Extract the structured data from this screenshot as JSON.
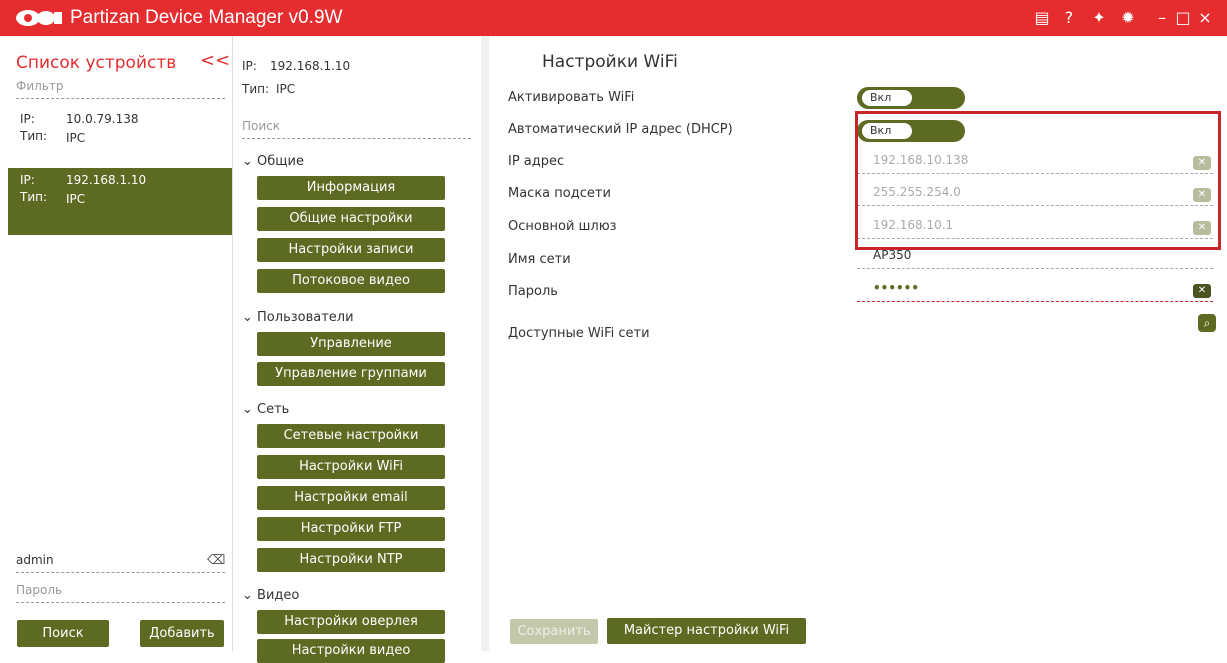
{
  "app": {
    "title": "Partizan Device Manager v0.9W"
  },
  "sidebar": {
    "title": "Список устройств",
    "collapse": "<<",
    "filter_placeholder": "Фильтр",
    "devices": [
      {
        "ip_label": "IP:",
        "ip": "10.0.79.138",
        "type_label": "Тип:",
        "type": "IPC"
      },
      {
        "ip_label": "IP:",
        "ip": "192.168.1.10",
        "type_label": "Тип:",
        "type": "IPC"
      }
    ],
    "username": "admin",
    "password_placeholder": "Пароль",
    "search_label": "Поиск",
    "add_label": "Добавить"
  },
  "device_info": {
    "ip_label": "IP:",
    "ip": "192.168.1.10",
    "type_label": "Тип:",
    "type": "IPC",
    "search_placeholder": "Поиск"
  },
  "menu": {
    "general": "Общие",
    "general_items": [
      "Информация",
      "Общие настройки",
      "Настройки записи",
      "Потоковое видео"
    ],
    "users": "Пользователи",
    "users_items": [
      "Управление пользователями",
      "Управление группами"
    ],
    "network": "Сеть",
    "network_items": [
      "Сетевые настройки",
      "Настройки WiFi",
      "Настройки email",
      "Настройки FTP",
      "Настройки NTP"
    ],
    "video": "Видео",
    "video_items": [
      "Настройки оверлея",
      "Настройки видео"
    ]
  },
  "wifi": {
    "title": "Настройки WiFi",
    "enable_label": "Активировать WiFi",
    "enable_value": "Вкл",
    "dhcp_label": "Автоматический IP адрес (DHCP)",
    "dhcp_value": "Вкл",
    "ip_label": "IP адрес",
    "ip_value": "192.168.10.138",
    "mask_label": "Маска подсети",
    "mask_value": "255.255.254.0",
    "gateway_label": "Основной шлюз",
    "gateway_value": "192.168.10.1",
    "ssid_label": "Имя сети",
    "ssid_value": "AP350",
    "password_label": "Пароль",
    "password_value": "••••••",
    "available_label": "Доступные WiFi сети",
    "save_label": "Сохранить",
    "wizard_label": "Майстер настройки WiFi"
  },
  "colors": {
    "titlebar": "#e52d2f",
    "accent": "#5d6a22",
    "highlight": "#c8242a"
  }
}
